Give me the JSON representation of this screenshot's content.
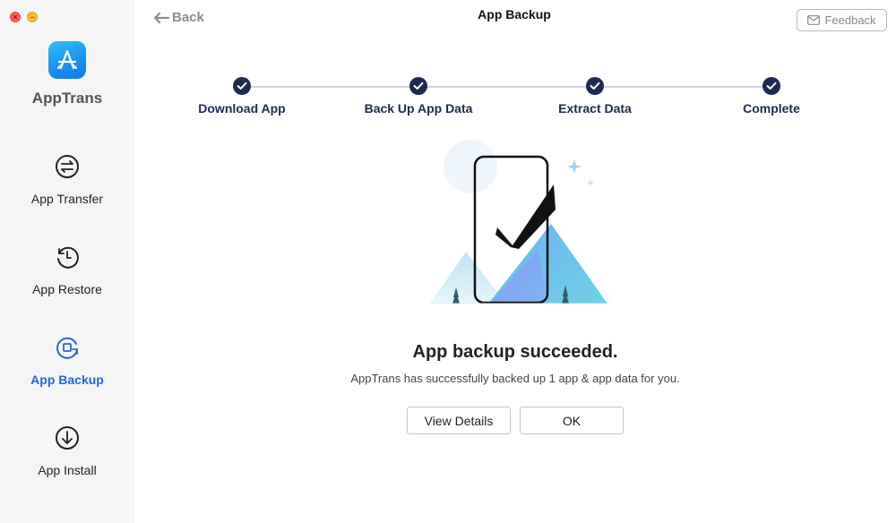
{
  "window": {
    "title": "App Backup",
    "back_label": "Back",
    "feedback_label": "Feedback"
  },
  "sidebar": {
    "app_name": "AppTrans",
    "items": [
      {
        "label": "App Transfer",
        "icon": "transfer-icon",
        "active": false
      },
      {
        "label": "App Restore",
        "icon": "restore-icon",
        "active": false
      },
      {
        "label": "App Backup",
        "icon": "backup-icon",
        "active": true
      },
      {
        "label": "App Install",
        "icon": "install-icon",
        "active": false
      }
    ]
  },
  "steps": [
    {
      "label": "Download App",
      "status": "done"
    },
    {
      "label": "Back Up App Data",
      "status": "done"
    },
    {
      "label": "Extract Data",
      "status": "done"
    },
    {
      "label": "Complete",
      "status": "done"
    }
  ],
  "result": {
    "title": "App backup succeeded.",
    "description": "AppTrans has successfully backed up 1 app & app data for you."
  },
  "buttons": {
    "view_details": "View Details",
    "ok": "OK"
  },
  "colors": {
    "accent": "#2467d9",
    "step_dark": "#1e2a50",
    "sidebar_bg": "#f5f5f6"
  }
}
